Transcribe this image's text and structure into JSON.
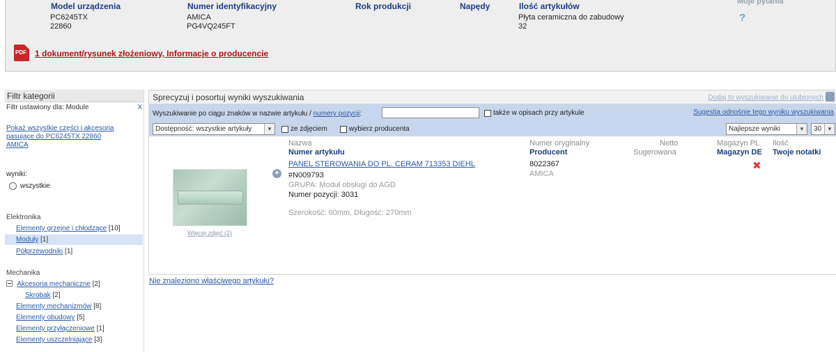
{
  "device": {
    "headers": {
      "model": "Model urządzenia",
      "ident": "Numer identyfikacyjny",
      "year": "Rok produkcji",
      "drives": "Napędy",
      "count": "Ilość artykułów",
      "questions": "Moje pytania"
    },
    "values": {
      "model_line1": "PC6245TX",
      "model_line2": "22860",
      "ident_line1": "AMICA",
      "ident_line2": "PG4VQ245FT",
      "type": "Płyta ceramiczna do zabudowy",
      "count": "32"
    },
    "question_icon": "?",
    "pdf_icon_text": "PDF",
    "pdf_link": "1 dokument/rysunek złożeniowy, Informacje o producencie"
  },
  "sidebar": {
    "title": "Filtr kategorii",
    "filter_set": "Filtr ustawiony dla: Module",
    "filter_clear": "X",
    "show_all_link": "Pokaż wszystkie części i akcesoria pasujące do PC6245TX 22860 AMICA",
    "results_label": "wyniki:",
    "radio_all": "wszystkie",
    "groups": [
      {
        "title": "Elektronika",
        "items": [
          {
            "label": "Elementy grzejne i chłodzące",
            "count": "[10]"
          },
          {
            "label": "Moduły",
            "count": "[1]"
          },
          {
            "label": "Półprzewodniki",
            "count": "[1]"
          }
        ]
      },
      {
        "title": "Mechanika",
        "items": [
          {
            "label": "Akcesoria mechaniczne",
            "count": "[2]"
          },
          {
            "label": "Skrobak",
            "count": "[2]"
          },
          {
            "label": "Elementy mechanizmów",
            "count": "[8]"
          },
          {
            "label": "Elementy obudowy",
            "count": "[5]"
          },
          {
            "label": "Elementy przyłączeniowe",
            "count": "[1]"
          },
          {
            "label": "Elementy uszczelniające",
            "count": "[3]"
          }
        ]
      }
    ]
  },
  "main": {
    "title": "Sprecyzuj i posortuj wyniki wyszukiwania",
    "fav_link": "Dodaj to wyszukiwanie do ulubionych",
    "search": {
      "label_prefix": "Wyszukiwanie po ciągu znaków w nazwie artykułu /",
      "label_link": "numery pozycji",
      "label_suffix": ":",
      "value": "",
      "also_desc": "także w opisach przy artykule",
      "suggest_link": "Sugestia odnośnie tego wyniku wyszukiwania",
      "availability": "Dostępność: wszystkie artykuły",
      "with_photo": "ze zdjęciem",
      "choose_producer": "wybierz producenta",
      "sort": "Najlepsze wyniki",
      "per_page": "30"
    },
    "columns": {
      "name": "Nazwa",
      "article_no": "Numer artykułu",
      "orig_no": "Numer oryginalny",
      "producer": "Producent",
      "netto": "Netto",
      "suggested": "Sugerowana",
      "stock_pl": "Magazyn PL",
      "stock_de": "Magazyn DE",
      "qty": "Ilość",
      "notes": "Twoje notatki"
    },
    "product": {
      "title": "PANEL STEROWANIA DO PL. CERAM 713353 DIEHL",
      "article_no": "#N009793",
      "group": "GRUPA: Moduł obsługi do AGD",
      "position_label": "Numer pozycji: 3031",
      "dimensions": "Szerokość: 60mm, Długość: 270mm",
      "orig_no": "8022367",
      "producer": "AMICA",
      "stock_mark": "✖",
      "more_photos": "Więcej zdjęć (2)",
      "plus": "+"
    }
  },
  "not_found_link": "Nie znaleziono właściwego artykułu?"
}
